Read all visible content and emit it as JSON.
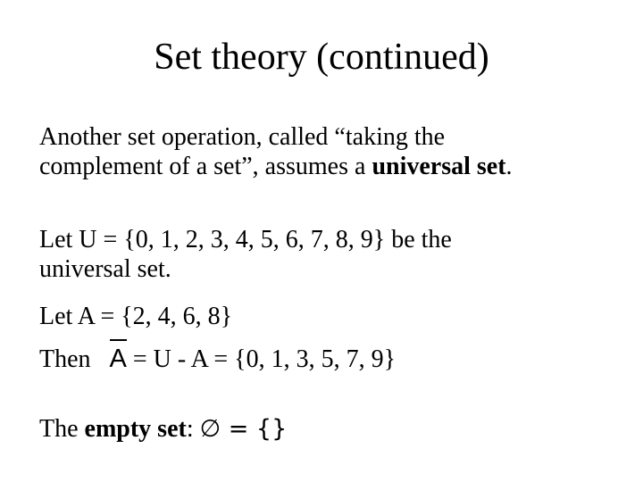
{
  "slide": {
    "title": "Set theory (continued)",
    "intro": {
      "line1": "Another set operation, called “taking the",
      "line2_prefix": "complement of a set”, assumes a ",
      "line2_bold": "universal set",
      "line2_suffix": "."
    },
    "universal": {
      "line1": "Let U = {0, 1, 2, 3, 4, 5, 6, 7, 8, 9} be the",
      "line2": "universal set."
    },
    "set_a": "Let A = {2, 4, 6, 8}",
    "complement": {
      "prefix": "Then",
      "symbol": "A",
      "expression": " = U - A = {0, 1, 3, 5, 7, 9}"
    },
    "empty_set": {
      "prefix": "The ",
      "bold": "empty set",
      "colon": ":  ",
      "symbol": "∅ = {}"
    }
  }
}
